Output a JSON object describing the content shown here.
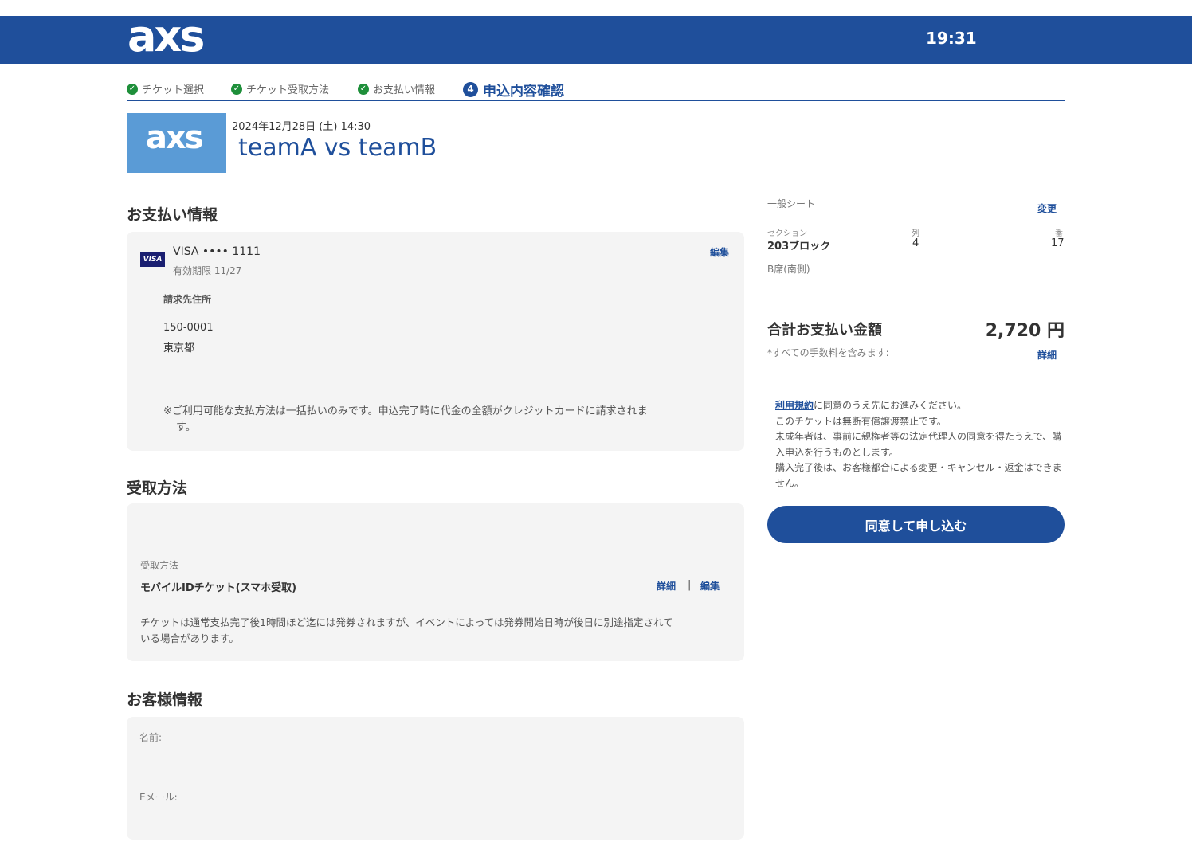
{
  "header": {
    "logo": "axs",
    "timer": "19:31"
  },
  "steps": [
    {
      "label": "チケット選択"
    },
    {
      "label": "チケット受取方法"
    },
    {
      "label": "お支払い情報"
    },
    {
      "number": "4",
      "label": "申込内容確認"
    }
  ],
  "event": {
    "thumb_logo": "axs",
    "date": "2024年12月28日 (土) 14:30",
    "title": "teamA vs teamB"
  },
  "payment": {
    "title": "お支払い情報",
    "card_brand": "VISA",
    "card_number": "VISA •••• 1111",
    "expiry": "有効期限 11/27",
    "edit": "編集",
    "billing_label": "請求先住所",
    "postal": "150-0001",
    "prefecture": "東京都",
    "note_line1": "※ご利用可能な支払方法は一括払いのみです。申込完了時に代金の全額がクレジットカードに請求されま",
    "note_line2": "す。"
  },
  "delivery": {
    "title": "受取方法",
    "label": "受取方法",
    "method": "モバイルIDチケット(スマホ受取)",
    "detail": "詳細",
    "separator": "|",
    "edit": "編集",
    "note_line1": "チケットは通常支払完了後1時間ほど迄には発券されますが、イベントによっては発券開始日時が後日に別途指定されて",
    "note_line2": "いる場合があります。"
  },
  "customer": {
    "title": "お客様情報",
    "name_label": "名前:",
    "email_label": "Eメール:"
  },
  "seat": {
    "type": "一般シート",
    "change": "変更",
    "section_label": "セクション",
    "section_value": "203ブロック",
    "row_label": "列",
    "row_value": "4",
    "number_label": "番",
    "number_value": "17",
    "area": "B席(南側)"
  },
  "total": {
    "label": "合計お支払い金額",
    "amount": "2,720 円",
    "note": "*すべての手数料を含みます:",
    "detail": "詳細"
  },
  "terms": {
    "link": "利用規約",
    "line1": "に同意のうえ先にお進みください。",
    "line2": "このチケットは無断有償譲渡禁止です。",
    "line3": "未成年者は、事前に親権者等の法定代理人の同意を得たうえで、購入申込を行うものとします。",
    "line4": "購入完了後は、お客様都合による変更・キャンセル・返金はできません。"
  },
  "submit": {
    "label": "同意して申し込む"
  },
  "colors": {
    "brand": "#1f4f9b",
    "check": "#1e8f3a",
    "card_bg": "#f4f4f4"
  },
  "icons": {
    "step_done": "check-circle-icon",
    "card": "visa-icon"
  }
}
